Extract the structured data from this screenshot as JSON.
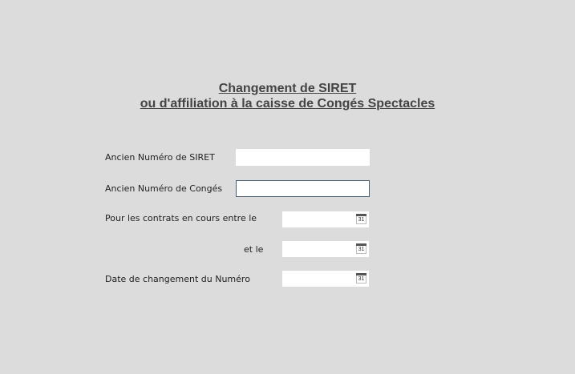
{
  "form": {
    "title_line1": "Changement de SIRET",
    "title_line2": "ou d'affiliation à la caisse de Congés Spectacles",
    "fields": {
      "ancien_siret": {
        "label": "Ancien Numéro de SIRET",
        "value": ""
      },
      "ancien_conges": {
        "label": "Ancien Numéro de Congés",
        "value": ""
      },
      "contrats_entre": {
        "label": "Pour les contrats en cours entre le",
        "value": "",
        "icon": "calendar-icon",
        "icon_text": "31"
      },
      "et_le": {
        "label": "et le",
        "value": "",
        "icon": "calendar-icon",
        "icon_text": "31"
      },
      "date_changement": {
        "label": "Date de changement du Numéro",
        "value": "",
        "icon": "calendar-icon",
        "icon_text": "31"
      }
    }
  },
  "colors": {
    "background": "#dcdcdc",
    "title": "#444444",
    "focus_border": "#4b5f72"
  }
}
